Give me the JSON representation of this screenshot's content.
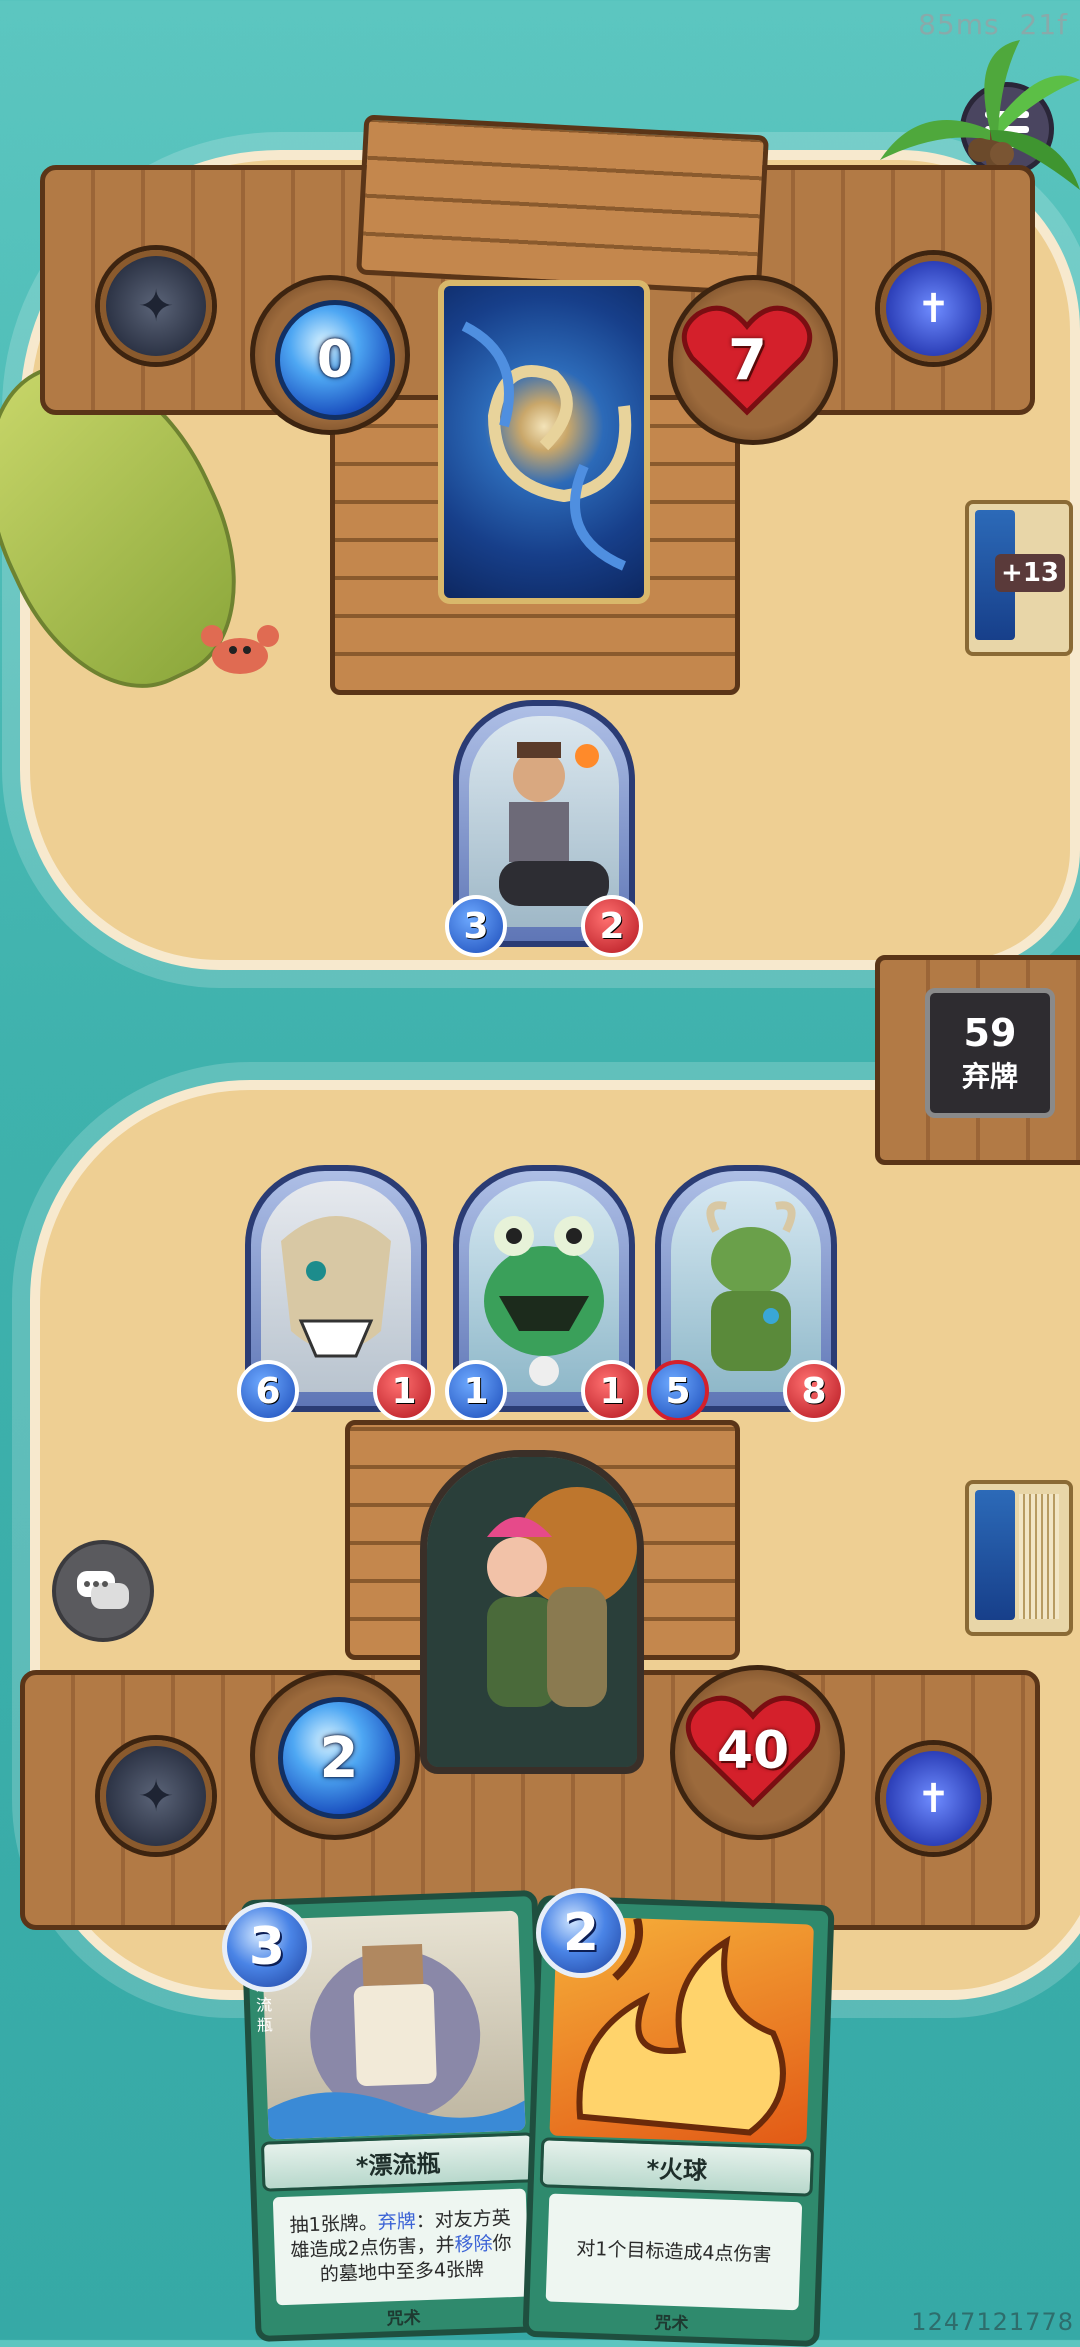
{
  "hud": {
    "ping": "85ms",
    "frames": "21f"
  },
  "opponent": {
    "mana": "0",
    "health": "7",
    "deck_count": "+13"
  },
  "discard": {
    "count": "59",
    "label": "弃牌"
  },
  "board": {
    "enemy_minions": [
      {
        "attack": "3",
        "health": "2"
      }
    ],
    "player_minions": [
      {
        "attack": "6",
        "health": "1"
      },
      {
        "attack": "1",
        "health": "1"
      },
      {
        "attack": "5",
        "health": "8"
      }
    ]
  },
  "player": {
    "mana": "2",
    "health": "40"
  },
  "hand": [
    {
      "cost": "3",
      "name": "*漂流瓶",
      "side_label": "漂流瓶",
      "desc_parts": [
        "抽1张牌。",
        "弃牌",
        "：对友方英雄造成2点伤害，并",
        "移除",
        "你的墓地中至多4张牌"
      ],
      "type": "咒术"
    },
    {
      "cost": "2",
      "name": "*火球",
      "desc": "对1个目标造成4点伤害",
      "type": "咒术"
    }
  ],
  "watermark": "1247121778",
  "colors": {
    "mana": "#1a4fbf",
    "health": "#d4202b",
    "card": "#2f8a6d",
    "keyword": "#3b63d6"
  },
  "icons": [
    "menu-icon",
    "chat-icon",
    "graveyard-icon",
    "hero-power-icon",
    "heart-icon",
    "gem-icon"
  ]
}
